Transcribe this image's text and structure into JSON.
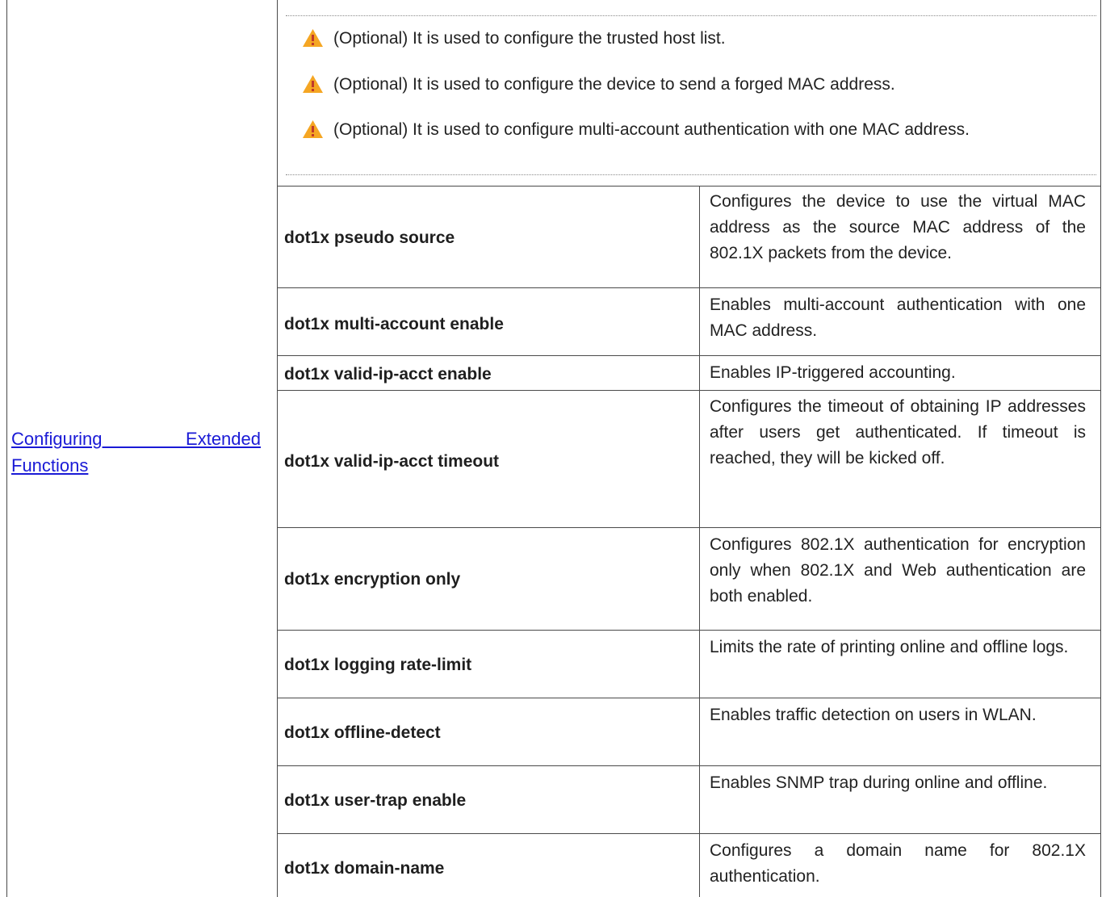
{
  "section_link": {
    "line1": "Configuring Extended",
    "line2": "Functions"
  },
  "notes": [
    "(Optional) It is used to configure the trusted host list.",
    "(Optional) It is used to configure the device to send a forged MAC address.",
    "(Optional) It is used to configure multi-account authentication with one MAC address."
  ],
  "icons": {
    "warning": "warning-triangle-icon",
    "warning_color": "#f5a623"
  },
  "rows": [
    {
      "command": "dot1x pseudo source",
      "description": "Configures the device to use the virtual MAC address as the source MAC address of the 802.1X packets from the device."
    },
    {
      "command": "dot1x multi-account enable",
      "description": "Enables multi-account authentication with one MAC address."
    },
    {
      "command": "dot1x valid-ip-acct enable",
      "description": "Enables IP-triggered accounting."
    },
    {
      "command": "dot1x valid-ip-acct timeout",
      "description": "Configures the timeout of obtaining IP addresses after users get authenticated. If timeout is reached, they will be kicked off."
    },
    {
      "command": "dot1x encryption only",
      "description": "Configures 802.1X authentication for encryption only when 802.1X and Web authentication are both enabled."
    },
    {
      "command": "dot1x logging rate-limit",
      "description": "Limits the rate of printing online and offline logs."
    },
    {
      "command": "dot1x offline-detect",
      "description": "Enables traffic detection on users in WLAN."
    },
    {
      "command": "dot1x user-trap enable",
      "description": "Enables SNMP trap during online and offline."
    },
    {
      "command": "dot1x domain-name",
      "description": "Configures a domain name for 802.1X authentication."
    }
  ]
}
